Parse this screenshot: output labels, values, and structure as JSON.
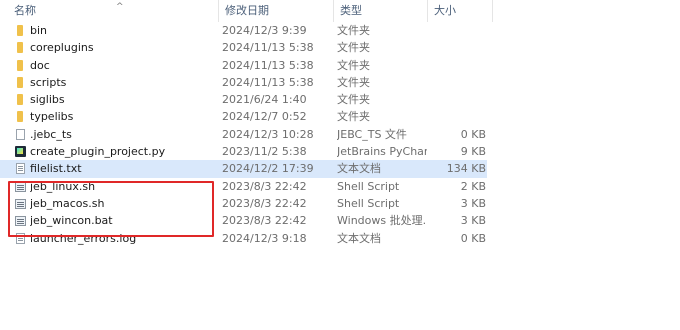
{
  "columns": {
    "name": "名称",
    "date": "修改日期",
    "type": "类型",
    "size": "大小"
  },
  "files": [
    {
      "name": "bin",
      "date": "2024/12/3 9:39",
      "type": "文件夹",
      "size": "",
      "icon": "folder-icon"
    },
    {
      "name": "coreplugins",
      "date": "2024/11/13 5:38",
      "type": "文件夹",
      "size": "",
      "icon": "folder-icon"
    },
    {
      "name": "doc",
      "date": "2024/11/13 5:38",
      "type": "文件夹",
      "size": "",
      "icon": "folder-icon"
    },
    {
      "name": "scripts",
      "date": "2024/11/13 5:38",
      "type": "文件夹",
      "size": "",
      "icon": "folder-icon"
    },
    {
      "name": "siglibs",
      "date": "2021/6/24 1:40",
      "type": "文件夹",
      "size": "",
      "icon": "folder-icon"
    },
    {
      "name": "typelibs",
      "date": "2024/12/7 0:52",
      "type": "文件夹",
      "size": "",
      "icon": "folder-icon"
    },
    {
      "name": ".jebc_ts",
      "date": "2024/12/3 10:28",
      "type": "JEBC_TS 文件",
      "size": "0 KB",
      "icon": "file-icon"
    },
    {
      "name": "create_plugin_project.py",
      "date": "2023/11/2 5:38",
      "type": "JetBrains PyChar...",
      "size": "9 KB",
      "icon": "python-file-icon"
    },
    {
      "name": "filelist.txt",
      "date": "2024/12/2 17:39",
      "type": "文本文档",
      "size": "134 KB",
      "icon": "text-file-icon",
      "selected": true
    },
    {
      "name": "jeb_linux.sh",
      "date": "2023/8/3 22:42",
      "type": "Shell Script",
      "size": "2 KB",
      "icon": "script-file-icon"
    },
    {
      "name": "jeb_macos.sh",
      "date": "2023/8/3 22:42",
      "type": "Shell Script",
      "size": "3 KB",
      "icon": "script-file-icon"
    },
    {
      "name": "jeb_wincon.bat",
      "date": "2023/8/3 22:42",
      "type": "Windows 批处理...",
      "size": "3 KB",
      "icon": "script-file-icon"
    },
    {
      "name": "launcher_errors.log",
      "date": "2024/12/3 9:18",
      "type": "文本文档",
      "size": "0 KB",
      "icon": "text-file-icon"
    }
  ],
  "colors": {
    "selection": "#d9e8fb",
    "highlight_border": "#e02828",
    "folder": "#f0c14b"
  }
}
